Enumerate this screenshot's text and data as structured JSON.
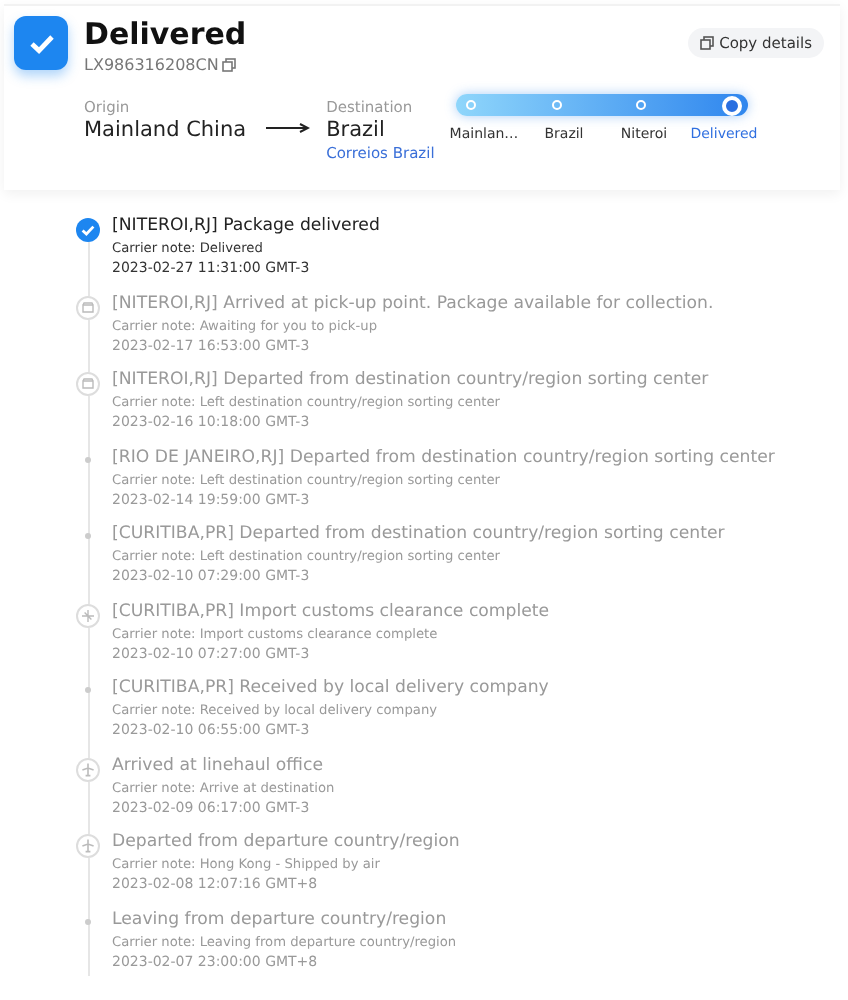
{
  "header": {
    "status": "Delivered",
    "tracking_number": "LX986316208CN",
    "copy_button": "Copy details"
  },
  "route": {
    "origin_label": "Origin",
    "origin": "Mainland China",
    "destination_label": "Destination",
    "destination": "Brazil",
    "carrier": "Correios Brazil"
  },
  "stages": [
    {
      "label": "Mainlan…",
      "selected": false
    },
    {
      "label": "Brazil",
      "selected": false
    },
    {
      "label": "Niteroi",
      "selected": false
    },
    {
      "label": "Delivered",
      "selected": true
    }
  ],
  "events": [
    {
      "kind": "done",
      "active": true,
      "title": "[NITEROI,RJ] Package delivered",
      "note": "Carrier note: Delivered",
      "time": "2023-02-27 11:31:00 GMT-3"
    },
    {
      "kind": "store",
      "active": false,
      "title": "[NITEROI,RJ] Arrived at pick-up point. Package available for collection.",
      "note": "Carrier note: Awaiting for you to pick-up",
      "time": "2023-02-17 16:53:00 GMT-3"
    },
    {
      "kind": "store",
      "active": false,
      "title": "[NITEROI,RJ] Departed from destination country/region sorting center",
      "note": "Carrier note: Left destination country/region sorting center",
      "time": "2023-02-16 10:18:00 GMT-3"
    },
    {
      "kind": "dot",
      "active": false,
      "title": "[RIO DE JANEIRO,RJ] Departed from destination country/region sorting center",
      "note": "Carrier note: Left destination country/region sorting center",
      "time": "2023-02-14 19:59:00 GMT-3"
    },
    {
      "kind": "dot",
      "active": false,
      "title": "[CURITIBA,PR] Departed from destination country/region sorting center",
      "note": "Carrier note: Left destination country/region sorting center",
      "time": "2023-02-10 07:29:00 GMT-3"
    },
    {
      "kind": "customs",
      "active": false,
      "title": "[CURITIBA,PR] Import customs clearance complete",
      "note": "Carrier note: Import customs clearance complete",
      "time": "2023-02-10 07:27:00 GMT-3"
    },
    {
      "kind": "dot",
      "active": false,
      "title": "[CURITIBA,PR] Received by local delivery company",
      "note": "Carrier note: Received by local delivery company",
      "time": "2023-02-10 06:55:00 GMT-3"
    },
    {
      "kind": "plane",
      "active": false,
      "title": "Arrived at linehaul office",
      "note": "Carrier note: Arrive at destination",
      "time": "2023-02-09 06:17:00 GMT-3"
    },
    {
      "kind": "plane",
      "active": false,
      "title": "Departed from departure country/region",
      "note": "Carrier note: Hong Kong - Shipped by air",
      "time": "2023-02-08 12:07:16 GMT+8"
    },
    {
      "kind": "dot",
      "active": false,
      "title": "Leaving from departure country/region",
      "note": "Carrier note: Leaving from departure country/region",
      "time": "2023-02-07 23:00:00 GMT+8"
    }
  ]
}
